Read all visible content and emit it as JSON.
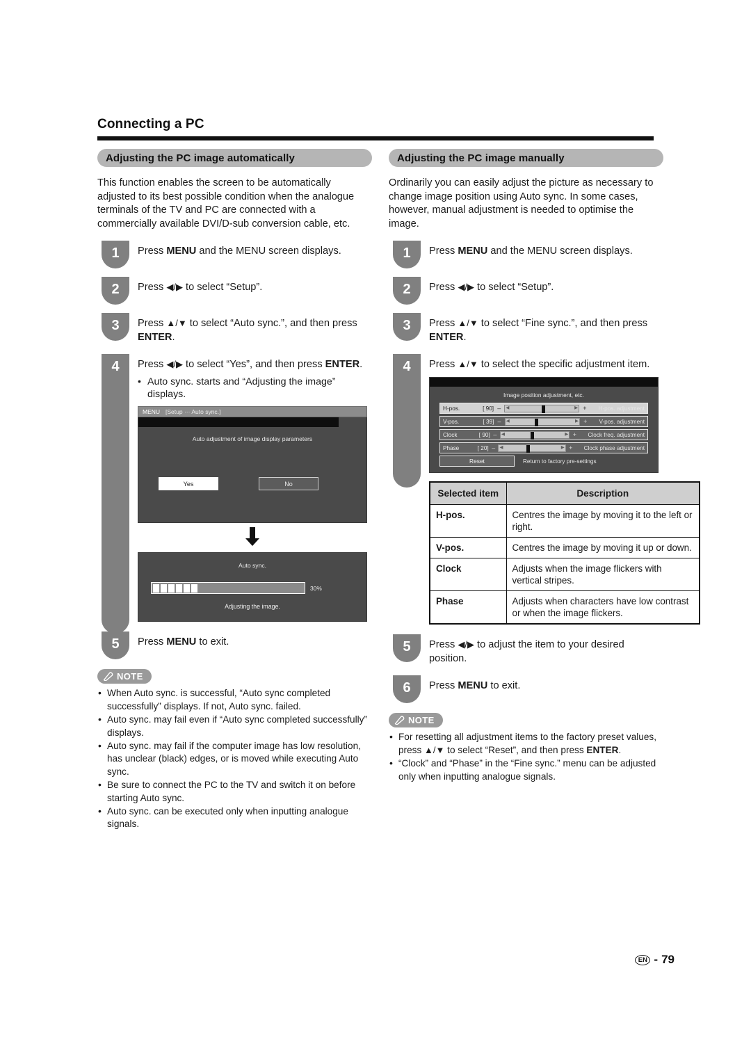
{
  "header": {
    "title": "Connecting a PC"
  },
  "left_column": {
    "section_title": "Adjusting the PC image automatically",
    "intro": "This function enables the screen to be automatically adjusted to its best possible condition when the analogue terminals of the TV and PC are connected with a commercially available DVI/D-sub conversion cable, etc.",
    "steps": [
      {
        "number": "1",
        "text_before": "Press ",
        "bold1": "MENU",
        "text_after": " and the MENU screen displays."
      },
      {
        "number": "2",
        "text_before": "Press ",
        "arrows": "◀/▶",
        "text_after": " to select “Setup”."
      },
      {
        "number": "3",
        "text_before": "Press ",
        "arrows": "▲/▼",
        "text_mid": " to select “Auto sync.”, and then press ",
        "bold1": "ENTER",
        "text_after": "."
      },
      {
        "number": "4",
        "text_before": "Press ",
        "arrows": "◀/▶",
        "text_mid": " to select “Yes”, and then press ",
        "bold1": "ENTER",
        "text_after": ".",
        "bullet": "Auto sync. starts and “Adjusting the image” displays."
      },
      {
        "number": "5",
        "text_before": "Press ",
        "bold1": "MENU",
        "text_after": " to exit."
      }
    ],
    "osd_dialog": {
      "menu_label": "MENU",
      "breadcrumb": "[Setup ··· Auto sync.]",
      "caption": "Auto adjustment of image display parameters",
      "button_yes": "Yes",
      "button_no": "No"
    },
    "osd_progress": {
      "title": "Auto sync.",
      "percent": "30%",
      "segments": 6,
      "status": "Adjusting the image."
    },
    "note": {
      "label": "NOTE",
      "items": [
        "When Auto sync. is successful, “Auto sync completed successfully” displays. If not, Auto sync. failed.",
        "Auto sync. may fail even if “Auto sync completed successfully” displays.",
        "Auto sync. may fail if the computer image has low resolution, has unclear (black) edges, or is moved while executing Auto sync.",
        "Be sure to connect the PC to the TV and switch it on before starting Auto sync.",
        "Auto sync. can be executed only when inputting analogue signals."
      ]
    }
  },
  "right_column": {
    "section_title": "Adjusting the PC image manually",
    "intro": "Ordinarily you can easily adjust the picture as necessary to change image position using Auto sync. In some cases, however, manual adjustment is needed to optimise the image.",
    "steps": [
      {
        "number": "1",
        "text_before": "Press ",
        "bold1": "MENU",
        "text_after": " and the MENU screen displays."
      },
      {
        "number": "2",
        "text_before": "Press ",
        "arrows": "◀/▶",
        "text_after": " to select “Setup”."
      },
      {
        "number": "3",
        "text_before": "Press ",
        "arrows": "▲/▼",
        "text_mid": " to select “Fine sync.”, and then press ",
        "bold1": "ENTER",
        "text_after": "."
      },
      {
        "number": "4",
        "text_before": "Press ",
        "arrows": "▲/▼",
        "text_after": " to select the specific adjustment item."
      },
      {
        "number": "5",
        "text_before": "Press ",
        "arrows": "◀/▶",
        "text_after": " to adjust the item to your desired position."
      },
      {
        "number": "6",
        "text_before": "Press ",
        "bold1": "MENU",
        "text_after": " to exit."
      }
    ],
    "osd_adjust": {
      "title": "Image position adjustment, etc.",
      "rows": [
        {
          "name": "H-pos.",
          "value": "[ 90]",
          "minus": "–",
          "plus": "+",
          "thumb_pct": 50,
          "description": "H-pos. adjustment",
          "selected": true
        },
        {
          "name": "V-pos.",
          "value": "[ 39]",
          "minus": "–",
          "plus": "+",
          "thumb_pct": 40,
          "description": "V-pos. adjustment",
          "selected": false
        },
        {
          "name": "Clock",
          "value": "[ 90]",
          "minus": "–",
          "plus": "+",
          "thumb_pct": 44,
          "description": "Clock freq. adjustment",
          "selected": false
        },
        {
          "name": "Phase",
          "value": "[ 20]",
          "minus": "–",
          "plus": "+",
          "thumb_pct": 41,
          "description": "Clock phase adjustment",
          "selected": false
        }
      ],
      "reset_label": "Reset",
      "reset_description": "Return to factory pre-settings"
    },
    "table": {
      "headers": [
        "Selected item",
        "Description"
      ],
      "rows": [
        {
          "item": "H-pos.",
          "description": "Centres the image by moving it to the left or right."
        },
        {
          "item": "V-pos.",
          "description": "Centres the image by moving it up or down."
        },
        {
          "item": "Clock",
          "description": "Adjusts when the image flickers with vertical stripes."
        },
        {
          "item": "Phase",
          "description": "Adjusts when characters have low contrast or when the image flickers."
        }
      ]
    },
    "note": {
      "label": "NOTE",
      "items": [
        {
          "part1": "For resetting all adjustment items to the factory preset values, press ",
          "arrows": "▲/▼",
          "part2": " to select “Reset”, and then press ",
          "bold": "ENTER",
          "part3": "."
        },
        {
          "part1": "“Clock” and “Phase” in the “Fine sync.” menu can be adjusted only when inputting analogue signals.",
          "arrows": "",
          "part2": "",
          "bold": "",
          "part3": ""
        }
      ]
    }
  },
  "footer": {
    "language_code": "EN",
    "separator": "-",
    "page_number": "79"
  }
}
